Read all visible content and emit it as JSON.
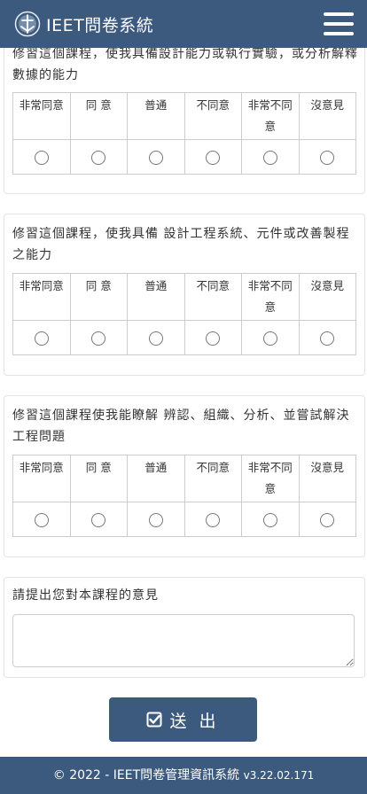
{
  "app": {
    "title": "IEET問卷系統",
    "logo_icon": "ieet-logo-icon",
    "menu_icon": "hamburger-menu-icon",
    "accent_color": "#3c5a7d"
  },
  "scale_headers": [
    "非常同意",
    "同 意",
    "普通",
    "不同意",
    "非常不同意",
    "沒意見"
  ],
  "questions": [
    {
      "text": "修習這個課程，使我具備設計能力或執行實驗，或分析解釋數據的能力"
    },
    {
      "text": "修習這個課程，使我具備 設計工程系統、元件或改善製程之能力"
    },
    {
      "text": "修習這個課程使我能瞭解 辨認、組織、分析、並嘗試解決工程問題"
    }
  ],
  "comment": {
    "label": "請提出您對本課程的意見",
    "value": ""
  },
  "submit": {
    "label": "送 出",
    "icon": "check-square-icon"
  },
  "footer": {
    "text": "© 2022 - IEET問卷管理資訊系統",
    "version": "v3.22.02.171"
  }
}
